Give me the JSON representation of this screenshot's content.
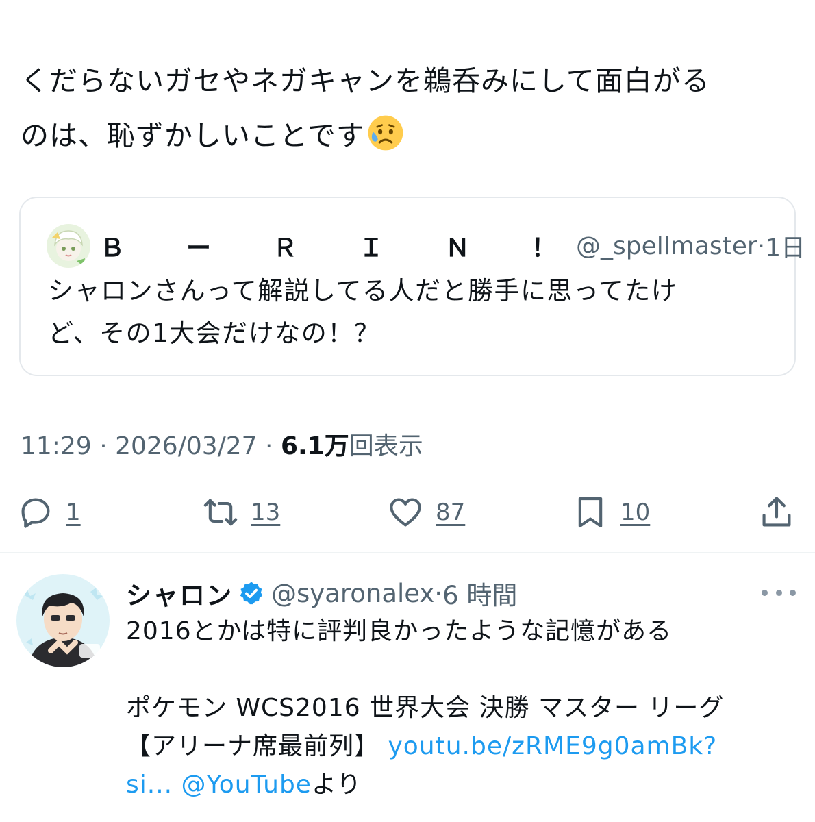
{
  "tweet": {
    "text_line1": "くだらないガセやネガキャンを鵜呑みにして面白がる",
    "text_line2": "のは、恥ずかしいことです",
    "emoji": "sad-but-relieved-face"
  },
  "quote": {
    "name": "Ｂ　ー　Ｒ　Ｉ　Ｎ　！",
    "handle": "@_spellmaster",
    "separator": " · ",
    "time": "1日",
    "line1": "シャロンさんって解説してる人だと勝手に思ってたけ",
    "line2": "ど、その1大会だけなの！？"
  },
  "meta": {
    "time": "11:29",
    "sep1": " · ",
    "date": "2026/03/27",
    "sep2": " · ",
    "views": "6.1万",
    "views_label": "回表示"
  },
  "actions": {
    "reply_count": "1",
    "retweet_count": "13",
    "like_count": "87",
    "bookmark_count": "10",
    "icons": [
      "reply-icon",
      "retweet-icon",
      "like-icon",
      "bookmark-icon",
      "share-icon"
    ]
  },
  "reply": {
    "name": "シャロン",
    "handle": "@syaronalex",
    "separator": " · ",
    "time": "6 時間",
    "line1": "2016とかは特に評判良かったような記憶がある",
    "line2": "ポケモン WCS2016 世界大会 決勝 マスター リーグ",
    "line3_text": "【アリーナ席最前列】 ",
    "line3_link": "youtu.be/zRME9g0amBk?",
    "line4_link1": "si...",
    "line4_space": " ",
    "line4_link2": "@YouTube",
    "line4_suffix": "より"
  },
  "colors": {
    "text": "#0f1419",
    "muted": "#536471",
    "link": "#1d9bf0",
    "border": "#e4e8ec"
  }
}
